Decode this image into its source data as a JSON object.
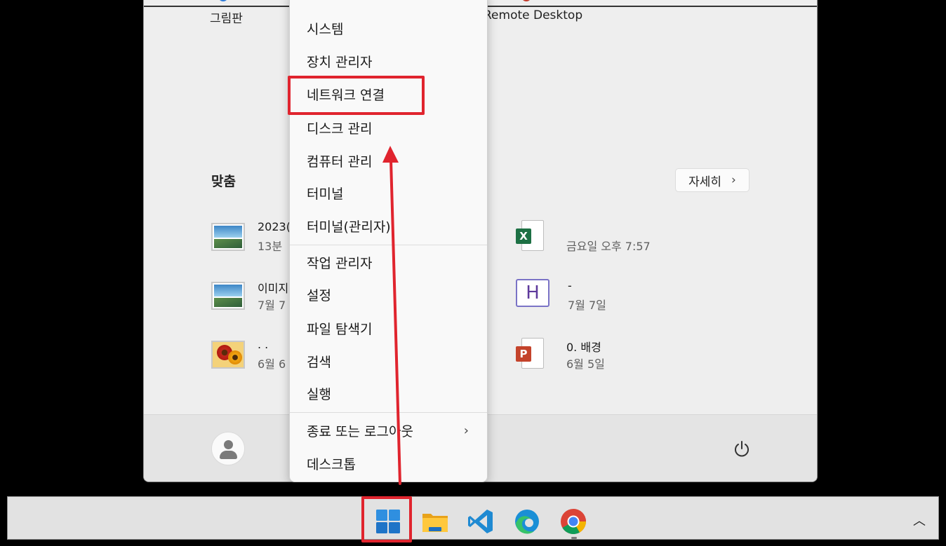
{
  "start_menu": {
    "pinned_labels": [
      "그림판",
      "Remote Desktop"
    ],
    "recommended_title": "맞춤",
    "more_button": {
      "label": "자세히",
      "icon": "chevron-right-icon"
    },
    "recommended": [
      {
        "name": "2023(",
        "time": "13분",
        "icon": "image-file-icon"
      },
      {
        "name": "",
        "time": "금요일 오후 7:57",
        "icon": "excel-file-icon"
      },
      {
        "name": "이미지",
        "time": "7월 7",
        "icon": "image-file-icon"
      },
      {
        "name": "-",
        "time": "7월 7일",
        "icon": "hwp-file-icon"
      },
      {
        "name": ". .",
        "time": "6월 6",
        "icon": "flower-image-icon"
      },
      {
        "name": "0. 배경",
        "time": "6월 5일",
        "icon": "powerpoint-file-icon"
      }
    ],
    "user_icon": "user-avatar-icon",
    "power_icon": "power-icon"
  },
  "context_menu": {
    "group1": [
      "시스템",
      "장치 관리자",
      "네트워크 연결",
      "디스크 관리",
      "컴퓨터 관리",
      "터미널",
      "터미널(관리자)"
    ],
    "group2": [
      "작업 관리자",
      "설정",
      "파일 탐색기",
      "검색",
      "실행"
    ],
    "group3": [
      {
        "label": "종료 또는 로그아웃",
        "submenu": true
      },
      {
        "label": "데스크톱",
        "submenu": false
      }
    ]
  },
  "taskbar": {
    "icons": [
      "windows-start-icon",
      "file-explorer-icon",
      "vscode-icon",
      "edge-icon",
      "chrome-icon"
    ],
    "tray": "chevron-up-icon"
  },
  "colors": {
    "annotation": "#e0242e",
    "start_bg": "#eeeeee",
    "menu_bg": "#f9f9f9"
  }
}
